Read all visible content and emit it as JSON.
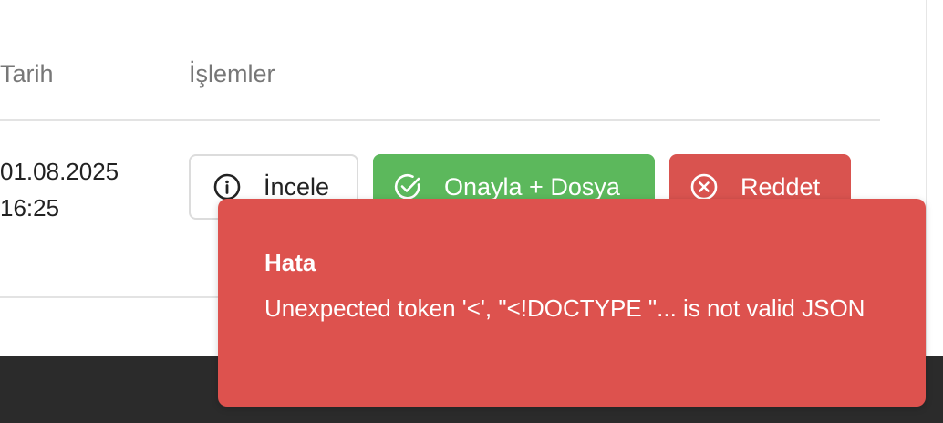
{
  "table": {
    "headers": {
      "date": "Tarih",
      "actions": "İşlemler"
    },
    "rows": [
      {
        "date_line1": "01.08.2025",
        "date_line2": "16:25",
        "actions": {
          "inspect_label": "İncele",
          "approve_label": "Onayla + Dosya",
          "reject_label": "Reddet"
        }
      }
    ]
  },
  "toast": {
    "title": "Hata",
    "message": "Unexpected token '<', \"<!DOCTYPE \"... is not valid JSON"
  },
  "colors": {
    "approve": "#5cb85c",
    "reject": "#d9534f",
    "toast_bg": "#dd524e",
    "footer": "#2b2b2b"
  },
  "icons": {
    "inspect": "info-circle-icon",
    "approve": "check-circle-icon",
    "reject": "x-circle-icon"
  }
}
